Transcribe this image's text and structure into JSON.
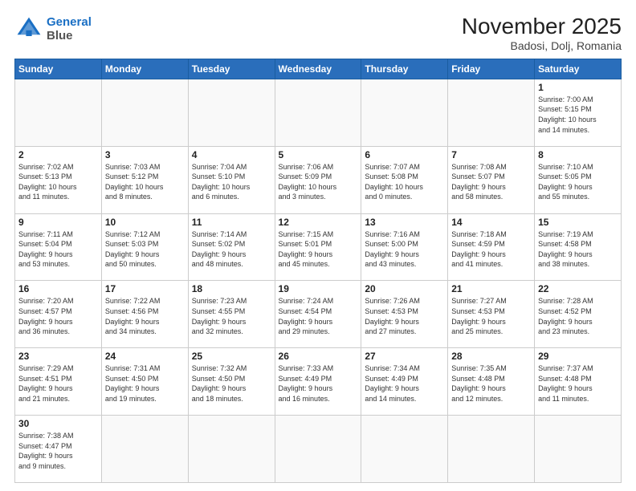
{
  "logo": {
    "line1": "General",
    "line2": "Blue"
  },
  "header": {
    "month_year": "November 2025",
    "location": "Badosi, Dolj, Romania"
  },
  "weekdays": [
    "Sunday",
    "Monday",
    "Tuesday",
    "Wednesday",
    "Thursday",
    "Friday",
    "Saturday"
  ],
  "weeks": [
    [
      {
        "day": "",
        "info": ""
      },
      {
        "day": "",
        "info": ""
      },
      {
        "day": "",
        "info": ""
      },
      {
        "day": "",
        "info": ""
      },
      {
        "day": "",
        "info": ""
      },
      {
        "day": "",
        "info": ""
      },
      {
        "day": "1",
        "info": "Sunrise: 7:00 AM\nSunset: 5:15 PM\nDaylight: 10 hours\nand 14 minutes."
      }
    ],
    [
      {
        "day": "2",
        "info": "Sunrise: 7:02 AM\nSunset: 5:13 PM\nDaylight: 10 hours\nand 11 minutes."
      },
      {
        "day": "3",
        "info": "Sunrise: 7:03 AM\nSunset: 5:12 PM\nDaylight: 10 hours\nand 8 minutes."
      },
      {
        "day": "4",
        "info": "Sunrise: 7:04 AM\nSunset: 5:10 PM\nDaylight: 10 hours\nand 6 minutes."
      },
      {
        "day": "5",
        "info": "Sunrise: 7:06 AM\nSunset: 5:09 PM\nDaylight: 10 hours\nand 3 minutes."
      },
      {
        "day": "6",
        "info": "Sunrise: 7:07 AM\nSunset: 5:08 PM\nDaylight: 10 hours\nand 0 minutes."
      },
      {
        "day": "7",
        "info": "Sunrise: 7:08 AM\nSunset: 5:07 PM\nDaylight: 9 hours\nand 58 minutes."
      },
      {
        "day": "8",
        "info": "Sunrise: 7:10 AM\nSunset: 5:05 PM\nDaylight: 9 hours\nand 55 minutes."
      }
    ],
    [
      {
        "day": "9",
        "info": "Sunrise: 7:11 AM\nSunset: 5:04 PM\nDaylight: 9 hours\nand 53 minutes."
      },
      {
        "day": "10",
        "info": "Sunrise: 7:12 AM\nSunset: 5:03 PM\nDaylight: 9 hours\nand 50 minutes."
      },
      {
        "day": "11",
        "info": "Sunrise: 7:14 AM\nSunset: 5:02 PM\nDaylight: 9 hours\nand 48 minutes."
      },
      {
        "day": "12",
        "info": "Sunrise: 7:15 AM\nSunset: 5:01 PM\nDaylight: 9 hours\nand 45 minutes."
      },
      {
        "day": "13",
        "info": "Sunrise: 7:16 AM\nSunset: 5:00 PM\nDaylight: 9 hours\nand 43 minutes."
      },
      {
        "day": "14",
        "info": "Sunrise: 7:18 AM\nSunset: 4:59 PM\nDaylight: 9 hours\nand 41 minutes."
      },
      {
        "day": "15",
        "info": "Sunrise: 7:19 AM\nSunset: 4:58 PM\nDaylight: 9 hours\nand 38 minutes."
      }
    ],
    [
      {
        "day": "16",
        "info": "Sunrise: 7:20 AM\nSunset: 4:57 PM\nDaylight: 9 hours\nand 36 minutes."
      },
      {
        "day": "17",
        "info": "Sunrise: 7:22 AM\nSunset: 4:56 PM\nDaylight: 9 hours\nand 34 minutes."
      },
      {
        "day": "18",
        "info": "Sunrise: 7:23 AM\nSunset: 4:55 PM\nDaylight: 9 hours\nand 32 minutes."
      },
      {
        "day": "19",
        "info": "Sunrise: 7:24 AM\nSunset: 4:54 PM\nDaylight: 9 hours\nand 29 minutes."
      },
      {
        "day": "20",
        "info": "Sunrise: 7:26 AM\nSunset: 4:53 PM\nDaylight: 9 hours\nand 27 minutes."
      },
      {
        "day": "21",
        "info": "Sunrise: 7:27 AM\nSunset: 4:53 PM\nDaylight: 9 hours\nand 25 minutes."
      },
      {
        "day": "22",
        "info": "Sunrise: 7:28 AM\nSunset: 4:52 PM\nDaylight: 9 hours\nand 23 minutes."
      }
    ],
    [
      {
        "day": "23",
        "info": "Sunrise: 7:29 AM\nSunset: 4:51 PM\nDaylight: 9 hours\nand 21 minutes."
      },
      {
        "day": "24",
        "info": "Sunrise: 7:31 AM\nSunset: 4:50 PM\nDaylight: 9 hours\nand 19 minutes."
      },
      {
        "day": "25",
        "info": "Sunrise: 7:32 AM\nSunset: 4:50 PM\nDaylight: 9 hours\nand 18 minutes."
      },
      {
        "day": "26",
        "info": "Sunrise: 7:33 AM\nSunset: 4:49 PM\nDaylight: 9 hours\nand 16 minutes."
      },
      {
        "day": "27",
        "info": "Sunrise: 7:34 AM\nSunset: 4:49 PM\nDaylight: 9 hours\nand 14 minutes."
      },
      {
        "day": "28",
        "info": "Sunrise: 7:35 AM\nSunset: 4:48 PM\nDaylight: 9 hours\nand 12 minutes."
      },
      {
        "day": "29",
        "info": "Sunrise: 7:37 AM\nSunset: 4:48 PM\nDaylight: 9 hours\nand 11 minutes."
      }
    ],
    [
      {
        "day": "30",
        "info": "Sunrise: 7:38 AM\nSunset: 4:47 PM\nDaylight: 9 hours\nand 9 minutes."
      },
      {
        "day": "",
        "info": ""
      },
      {
        "day": "",
        "info": ""
      },
      {
        "day": "",
        "info": ""
      },
      {
        "day": "",
        "info": ""
      },
      {
        "day": "",
        "info": ""
      },
      {
        "day": "",
        "info": ""
      }
    ]
  ]
}
